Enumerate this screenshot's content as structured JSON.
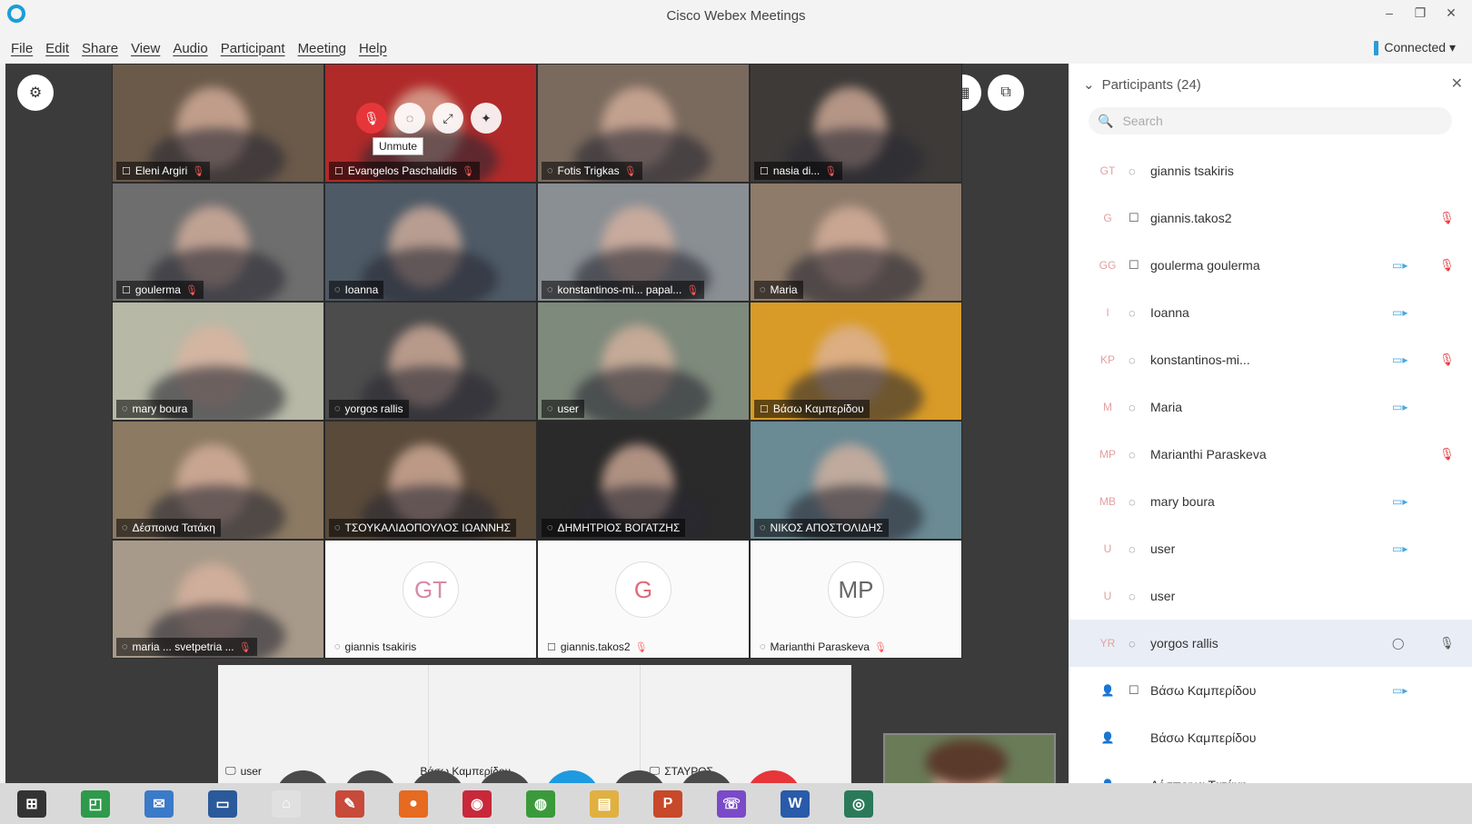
{
  "window": {
    "title": "Cisco Webex Meetings",
    "minimize": "–",
    "maximize": "❐",
    "close": "✕"
  },
  "menu": [
    "File",
    "Edit",
    "Share",
    "View",
    "Audio",
    "Participant",
    "Meeting",
    "Help"
  ],
  "status": {
    "connected": "Connected ▾"
  },
  "tiles": [
    {
      "name": "Eleni Argiri",
      "device": "phone",
      "muted": true,
      "bg": "#6b5a4a"
    },
    {
      "name": "Evangelos Paschalidis",
      "device": "phone",
      "muted": true,
      "bg": "#b02a2a"
    },
    {
      "name": "Fotis Trigkas",
      "device": "computer",
      "muted": true,
      "bg": "#7a6a5e"
    },
    {
      "name": "nasia di...",
      "device": "phone",
      "muted": true,
      "bg": "#3d3a38"
    },
    {
      "name": "goulerma",
      "device": "phone",
      "muted": true,
      "bg": "#6e6e6e"
    },
    {
      "name": "Ioanna",
      "device": "computer",
      "muted": false,
      "bg": "#4e5a66"
    },
    {
      "name": "konstantinos-mi... papal...",
      "device": "computer",
      "muted": true,
      "bg": "#8a8f94"
    },
    {
      "name": "Maria",
      "device": "computer",
      "muted": false,
      "bg": "#8e7b6a"
    },
    {
      "name": "mary boura",
      "device": "computer",
      "muted": false,
      "bg": "#b7b8a6"
    },
    {
      "name": "yorgos rallis",
      "device": "computer",
      "muted": false,
      "bg": "#4c4c4c"
    },
    {
      "name": "user",
      "device": "computer",
      "muted": false,
      "bg": "#7e8a7c"
    },
    {
      "name": "Βάσω Καμπερίδου",
      "device": "phone",
      "muted": false,
      "bg": "#d99b27"
    },
    {
      "name": "Δέσποινα Τατάκη",
      "device": "computer",
      "muted": false,
      "bg": "#8c7a63"
    },
    {
      "name": "ΤΣΟΥΚΑΛΙΔΟΠΟΥΛΟΣ ΙΩΑΝΝΗΣ",
      "device": "computer",
      "muted": false,
      "bg": "#5a4a3a"
    },
    {
      "name": "ΔΗΜΗΤΡΙΟΣ ΒΟΓΑΤΖΗΣ",
      "device": "computer",
      "muted": false,
      "bg": "#2a2a2a"
    },
    {
      "name": "ΝΙΚΟΣ ΑΠΟΣΤΟΛΙΔΗΣ",
      "device": "computer",
      "muted": false,
      "bg": "#6a8a94"
    },
    {
      "name": "maria ... svetpetria ...",
      "device": "computer",
      "muted": true,
      "bg": "#a89a8a"
    }
  ],
  "avatar_tiles": [
    {
      "initials": "GT",
      "name": "giannis tsakiris",
      "device": "computer",
      "muted": false,
      "color": "#d98aa8"
    },
    {
      "initials": "G",
      "name": "giannis.takos2",
      "device": "phone",
      "muted": true,
      "color": "#e06a7a"
    },
    {
      "initials": "MP",
      "name": "Marianthi Paraskeva",
      "device": "computer",
      "muted": true,
      "color": "#666"
    }
  ],
  "row6": [
    {
      "name": "user"
    },
    {
      "name": "Βάσω Καμπερίδου"
    },
    {
      "name": "ΣΤΑΥΡΟΣ"
    }
  ],
  "unmute_tooltip": "Unmute",
  "controls": [
    {
      "name": "mute-button",
      "glyph": "🎙"
    },
    {
      "name": "video-button",
      "glyph": "📷"
    },
    {
      "name": "share-button",
      "glyph": "⇪"
    },
    {
      "name": "record-button",
      "glyph": "◉"
    },
    {
      "name": "participants-button",
      "glyph": "👤"
    },
    {
      "name": "chat-button",
      "glyph": "💬"
    },
    {
      "name": "more-button",
      "glyph": "···"
    },
    {
      "name": "end-call-button",
      "glyph": "✕"
    }
  ],
  "panel": {
    "title": "Participants (24)",
    "search_placeholder": "Search",
    "rows": [
      {
        "initials": "GT",
        "name": "giannis tsakiris",
        "device": "computer",
        "cam": false,
        "mic": false
      },
      {
        "initials": "G",
        "name": "giannis.takos2",
        "device": "phone",
        "cam": false,
        "mic": true
      },
      {
        "initials": "GG",
        "name": "goulerma goulerma",
        "device": "phone",
        "cam": true,
        "mic": true
      },
      {
        "initials": "I",
        "name": "Ioanna",
        "device": "computer",
        "cam": true,
        "mic": false
      },
      {
        "initials": "KP",
        "name": "konstantinos-mi...",
        "device": "computer",
        "cam": true,
        "mic": true
      },
      {
        "initials": "M",
        "name": "Maria",
        "device": "computer",
        "cam": true,
        "mic": false
      },
      {
        "initials": "MP",
        "name": "Marianthi Paraskeva",
        "device": "computer",
        "cam": false,
        "mic": true
      },
      {
        "initials": "MB",
        "name": "mary boura",
        "device": "computer",
        "cam": true,
        "mic": false
      },
      {
        "initials": "U",
        "name": "user",
        "device": "computer",
        "cam": true,
        "mic": false
      },
      {
        "initials": "U",
        "name": "user",
        "device": "computer",
        "cam": false,
        "mic": false
      },
      {
        "initials": "YR",
        "name": "yorgos rallis",
        "device": "computer",
        "cam": false,
        "mic": false,
        "selected": true
      },
      {
        "initials": "👤",
        "name": "Βάσω Καμπερίδου",
        "device": "phone",
        "cam": true,
        "mic": false
      },
      {
        "initials": "👤",
        "name": "Βάσω Καμπερίδου",
        "device": "",
        "cam": false,
        "mic": false
      },
      {
        "initials": "👤",
        "name": "Δέσποινα Τατάκη",
        "device": "computer",
        "cam": true,
        "mic": false
      }
    ]
  },
  "taskbar": [
    {
      "name": "start",
      "glyph": "⊞",
      "color": "#333"
    },
    {
      "name": "app-green",
      "glyph": "◰",
      "color": "#2e9a4a"
    },
    {
      "name": "mail",
      "glyph": "✉",
      "color": "#3a7ac8"
    },
    {
      "name": "display",
      "glyph": "▭",
      "color": "#2a5a9a"
    },
    {
      "name": "home",
      "glyph": "⌂",
      "color": "#e0e0e0"
    },
    {
      "name": "tools",
      "glyph": "✎",
      "color": "#c84a3a"
    },
    {
      "name": "firefox",
      "glyph": "●",
      "color": "#e66a20"
    },
    {
      "name": "app-red",
      "glyph": "◉",
      "color": "#c8283a"
    },
    {
      "name": "chrome",
      "glyph": "◍",
      "color": "#3a9a3a"
    },
    {
      "name": "explorer",
      "glyph": "▤",
      "color": "#e0b040"
    },
    {
      "name": "powerpoint",
      "glyph": "P",
      "color": "#c8482a"
    },
    {
      "name": "viber",
      "glyph": "☏",
      "color": "#7a4ac8"
    },
    {
      "name": "word",
      "glyph": "W",
      "color": "#2a5aaa"
    },
    {
      "name": "webex",
      "glyph": "◎",
      "color": "#2a7a5a"
    }
  ]
}
